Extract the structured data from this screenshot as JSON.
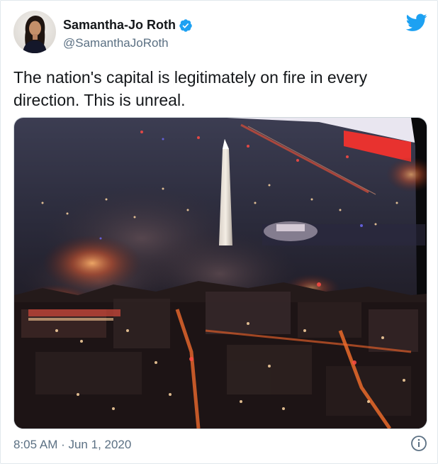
{
  "tweet": {
    "display_name": "Samantha-Jo Roth",
    "handle": "@SamanthaJoRoth",
    "verified": true,
    "text": "The nation's capital is legitimately on fire in every direction. This is unreal.",
    "timestamp": "8:05 AM · Jun 1, 2020"
  },
  "icons": {
    "verified": "verified-badge-icon",
    "brand": "twitter-bird-icon",
    "info": "info-icon",
    "avatar": "avatar-photo"
  },
  "colors": {
    "brand": "#1da1f2",
    "name": "#14171a",
    "secondary": "#5b7083",
    "border": "#e1e8ed"
  }
}
